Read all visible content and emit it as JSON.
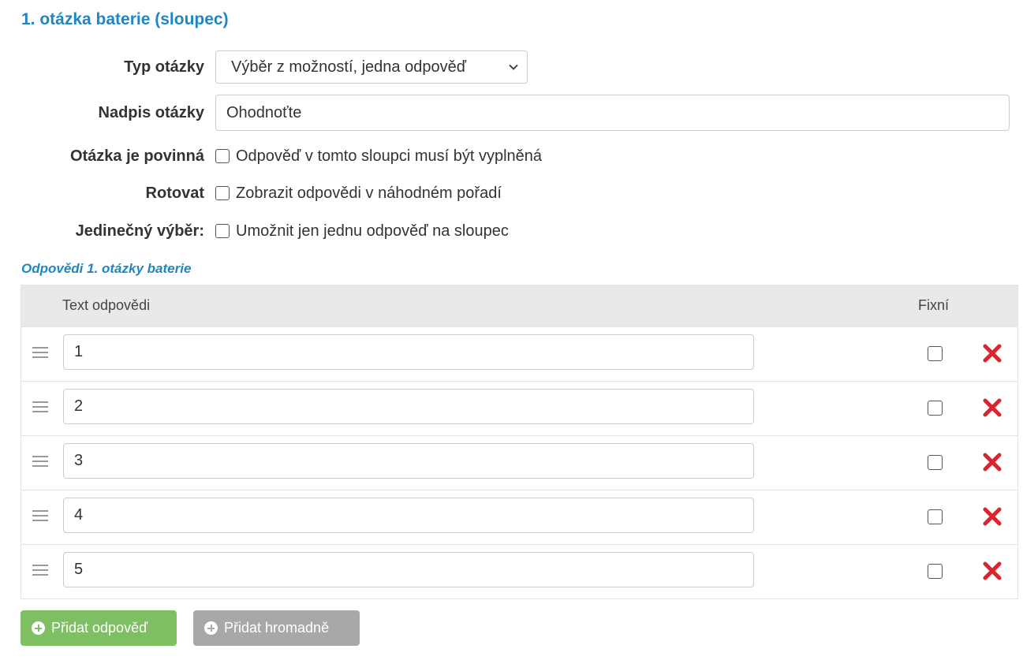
{
  "section_title": "1. otázka baterie (sloupec)",
  "question_type": {
    "label": "Typ otázky",
    "selected": "Výběr z možností, jedna odpověď"
  },
  "question_title": {
    "label": "Nadpis otázky",
    "value": "Ohodnoťte"
  },
  "required": {
    "label": "Otázka je povinná",
    "text": "Odpověď v tomto sloupci musí být vyplněná"
  },
  "rotate": {
    "label": "Rotovat",
    "text": "Zobrazit odpovědi v náhodném pořadí"
  },
  "unique": {
    "label": "Jedinečný výběr:",
    "text": "Umožnit jen jednu odpověď na sloupec"
  },
  "answers_heading": "Odpovědi 1. otázky baterie",
  "table": {
    "col_text": "Text odpovědi",
    "col_fixed": "Fixní",
    "rows": [
      {
        "value": "1"
      },
      {
        "value": "2"
      },
      {
        "value": "3"
      },
      {
        "value": "4"
      },
      {
        "value": "5"
      }
    ]
  },
  "buttons": {
    "add": "Přidat odpověď",
    "bulk_add": "Přidat hromadně"
  },
  "colors": {
    "accent": "#1f86c0",
    "green": "#7dbf62",
    "gray": "#a8a8a8",
    "delete": "#d9262e"
  }
}
